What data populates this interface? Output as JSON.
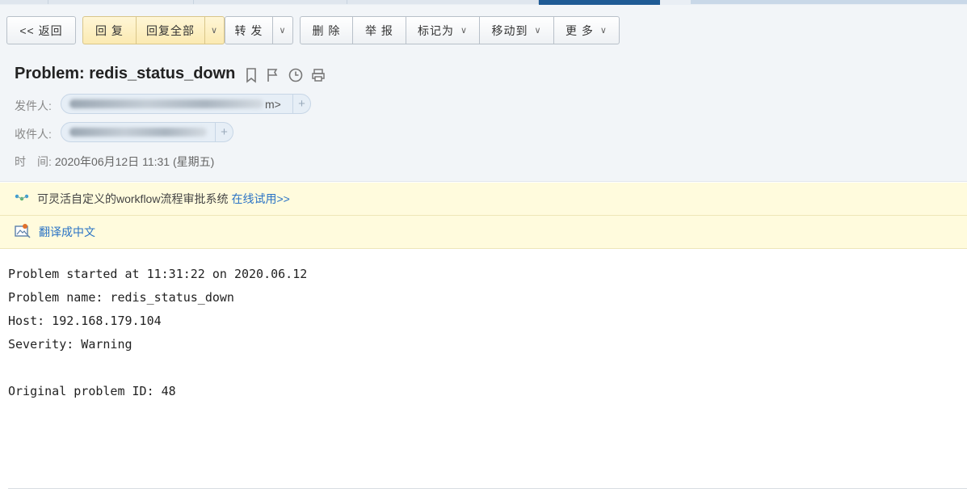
{
  "toolbar": {
    "back": "<< 返回",
    "reply": "回 复",
    "reply_all": "回复全部",
    "forward": "转 发",
    "delete": "删 除",
    "report": "举 报",
    "mark_as": "标记为",
    "move_to": "移动到",
    "more": "更 多",
    "caret": "∨"
  },
  "message": {
    "subject": "Problem: redis_status_down",
    "sender_label": "发件人:",
    "sender_tail": "m>",
    "recipient_label": "收件人:",
    "time_label": "时　间:",
    "time_value": "2020年06月12日 11:31 (星期五)",
    "add_symbol": "+"
  },
  "banners": {
    "workflow_text": "可灵活自定义的workflow流程审批系统",
    "workflow_link": "在线试用>>",
    "translate": "翻译成中文"
  },
  "body_lines": {
    "line1": "Problem started at 11:31:22 on 2020.06.12",
    "line2": "Problem name: redis_status_down",
    "line3": "Host: 192.168.179.104",
    "line4": "Severity: Warning",
    "line5": "",
    "line6": "Original problem ID: 48"
  },
  "colors": {
    "accent": "#1f5b95",
    "link": "#2a73c5",
    "banner_bg": "#fffbdd",
    "reply_bg": "#fbeab2"
  },
  "icons": [
    "bookmark-icon",
    "flag-icon",
    "clock-icon",
    "print-icon",
    "workflow-icon",
    "translate-icon"
  ]
}
